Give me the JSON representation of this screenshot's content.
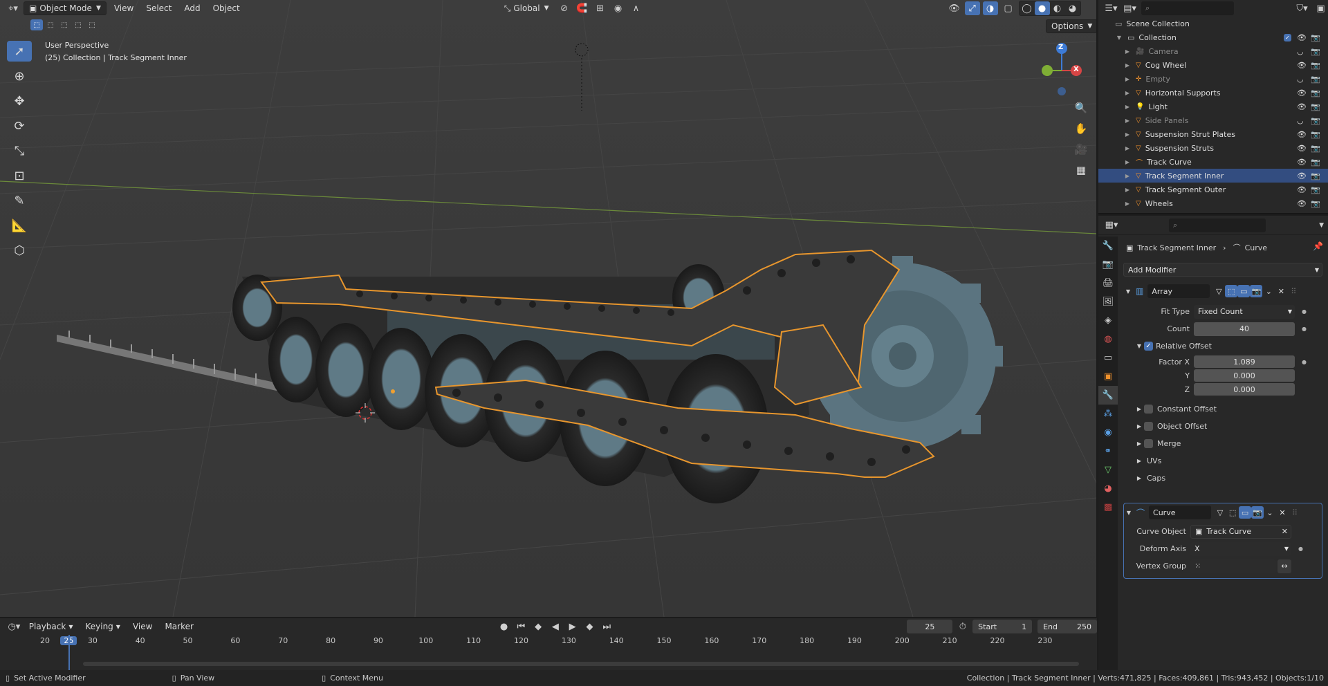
{
  "viewport": {
    "mode": "Object Mode",
    "menus": [
      "View",
      "Select",
      "Add",
      "Object"
    ],
    "transform_orientation": "Global",
    "options_label": "Options",
    "perspective": "User Perspective",
    "context": "(25) Collection | Track Segment Inner",
    "gizmo": {
      "z": "Z",
      "x": "X"
    }
  },
  "timeline": {
    "menus": [
      "Playback",
      "Keying",
      "View",
      "Marker"
    ],
    "current_frame": "25",
    "start_label": "Start",
    "start": "1",
    "end_label": "End",
    "end": "250",
    "ticks": [
      "20",
      "25",
      "30",
      "40",
      "50",
      "60",
      "70",
      "80",
      "90",
      "100",
      "110",
      "120",
      "130",
      "140",
      "150",
      "160",
      "170",
      "180",
      "190",
      "200",
      "210",
      "220",
      "230"
    ]
  },
  "status": {
    "left1": "Set Active Modifier",
    "left2": "Pan View",
    "left3": "Context Menu",
    "right": "Collection | Track Segment Inner | Verts:471,825 | Faces:409,861 | Tris:943,452 | Objects:1/10"
  },
  "outliner": {
    "scene_collection": "Scene Collection",
    "collection": "Collection",
    "items": [
      {
        "name": "Camera",
        "dim": true
      },
      {
        "name": "Cog Wheel",
        "dim": false
      },
      {
        "name": "Empty",
        "dim": true
      },
      {
        "name": "Horizontal Supports",
        "dim": false
      },
      {
        "name": "Light",
        "dim": false
      },
      {
        "name": "Side Panels",
        "dim": true
      },
      {
        "name": "Suspension Strut Plates",
        "dim": false
      },
      {
        "name": "Suspension Struts",
        "dim": false
      },
      {
        "name": "Track Curve",
        "dim": false
      },
      {
        "name": "Track Segment Inner",
        "dim": false,
        "selected": true
      },
      {
        "name": "Track Segment Outer",
        "dim": false
      },
      {
        "name": "Wheels",
        "dim": false
      }
    ]
  },
  "properties": {
    "breadcrumb_object": "Track Segment Inner",
    "breadcrumb_data": "Curve",
    "add_modifier": "Add Modifier",
    "array": {
      "name": "Array",
      "fit_type_label": "Fit Type",
      "fit_type": "Fixed Count",
      "count_label": "Count",
      "count": "40",
      "relative_offset_label": "Relative Offset",
      "factor_x_label": "Factor X",
      "factor_x": "1.089",
      "y_label": "Y",
      "y": "0.000",
      "z_label": "Z",
      "z": "0.000",
      "constant_offset": "Constant Offset",
      "object_offset": "Object Offset",
      "merge": "Merge",
      "uvs": "UVs",
      "caps": "Caps"
    },
    "curve": {
      "name": "Curve",
      "curve_object_label": "Curve Object",
      "curve_object": "Track Curve",
      "deform_axis_label": "Deform Axis",
      "deform_axis": "X",
      "vertex_group_label": "Vertex Group"
    }
  }
}
